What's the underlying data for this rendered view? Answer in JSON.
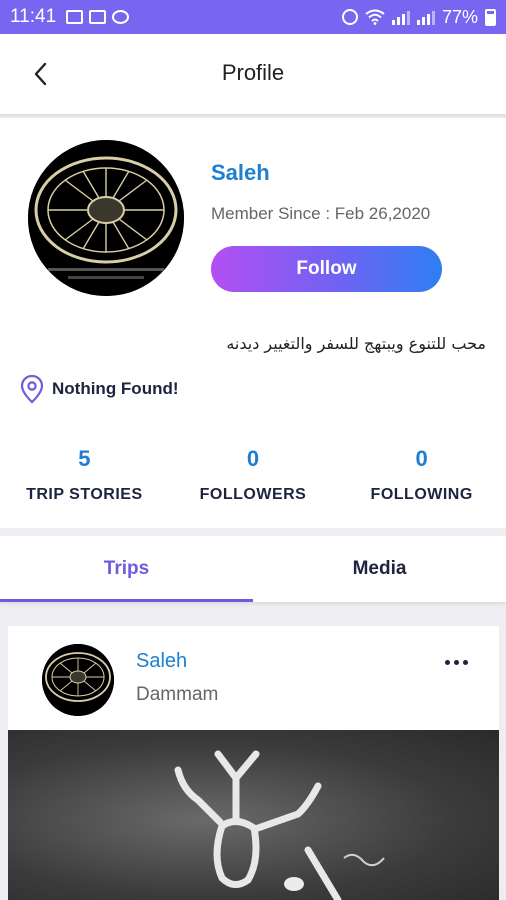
{
  "status_bar": {
    "time": "11:41",
    "battery_percent": "77%",
    "battery_level": 0.77
  },
  "header": {
    "title": "Profile"
  },
  "profile": {
    "name": "Saleh",
    "member_since": "Member Since : Feb 26,2020",
    "follow_label": "Follow",
    "bio": "محب للتنوع ويبتهج للسفر والتغيير ديدنه",
    "location_text": "Nothing Found!",
    "stats": [
      {
        "value": "5",
        "label": "TRIP STORIES"
      },
      {
        "value": "0",
        "label": "FOLLOWERS"
      },
      {
        "value": "0",
        "label": "FOLLOWING"
      }
    ]
  },
  "tabs": [
    {
      "label": "Trips",
      "active": true
    },
    {
      "label": "Media",
      "active": false
    }
  ],
  "post": {
    "user": "Saleh",
    "location": "Dammam"
  },
  "colors": {
    "accent": "#7866f0",
    "link_blue": "#1e7fd0",
    "tab_active": "#6f5ae0",
    "dark_text": "#1e2340"
  }
}
